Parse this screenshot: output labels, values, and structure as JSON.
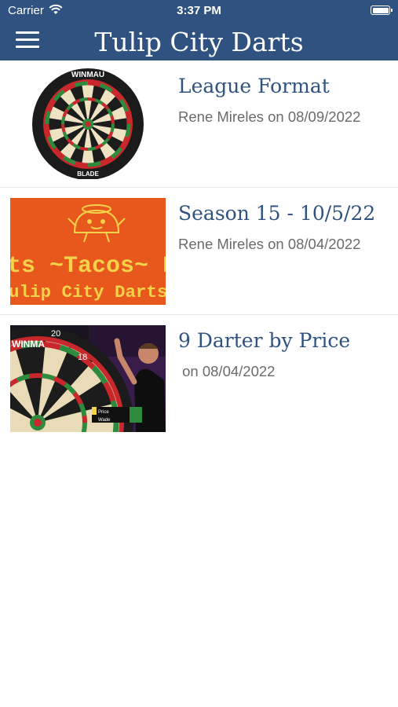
{
  "status_bar": {
    "carrier": "Carrier",
    "time": "3:37 PM"
  },
  "header": {
    "title": "Tulip City Darts",
    "menu_icon": "hamburger-menu-icon"
  },
  "posts": [
    {
      "title": "League Format",
      "meta": "Rene Mireles on 08/09/2022",
      "thumbnail": "dartboard-image",
      "thumb_text": [
        "WINMAU",
        "BLADE"
      ]
    },
    {
      "title": "Season 15 - 10/5/22",
      "meta": "Rene Mireles on 08/04/2022",
      "thumbnail": "tacos-flyer-image",
      "thumb_text": [
        "ts ~Tacos~ B",
        "ulip City Darts Clu"
      ],
      "thumb_colors": {
        "background": "#e8581c",
        "text": "#f4d24a"
      }
    },
    {
      "title": "9 Darter by Price",
      "meta": " on 08/04/2022",
      "thumbnail": "darts-match-video-image",
      "thumb_text": [
        "WINMA",
        "20",
        "18",
        "Price",
        "Wade"
      ]
    }
  ],
  "colors": {
    "header": "#2f5280",
    "title_text": "#2f5280",
    "meta_text": "#6b6b6b"
  }
}
